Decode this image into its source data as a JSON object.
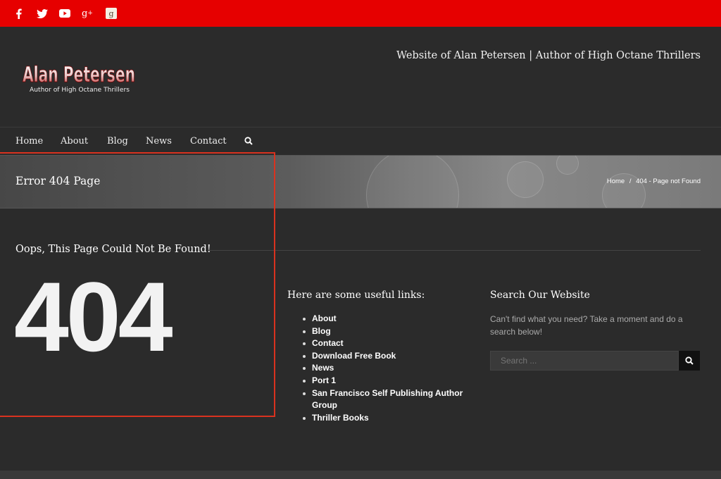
{
  "social": {
    "icons": [
      "facebook-icon",
      "twitter-icon",
      "youtube-icon",
      "google-plus-icon",
      "goodreads-icon"
    ]
  },
  "header": {
    "tagline": "Website of Alan Petersen | Author of High Octane Thrillers",
    "logo_name": "Alan Petersen",
    "logo_sub": "Author of High Octane Thrillers"
  },
  "nav": {
    "items": [
      "Home",
      "About",
      "Blog",
      "News",
      "Contact"
    ],
    "search_icon": "search-icon"
  },
  "page_title": {
    "title": "Error 404 Page",
    "breadcrumb": {
      "home": "Home",
      "separator": "/",
      "current": "404 - Page not Found"
    }
  },
  "main": {
    "heading": "Oops, This Page Could Not Be Found!",
    "code": "404"
  },
  "links": {
    "title": "Here are some useful links:",
    "items": [
      "About",
      "Blog",
      "Contact",
      "Download Free Book",
      "News",
      "Port 1",
      "San Francisco Self Publishing Author Group",
      "Thriller Books"
    ]
  },
  "search": {
    "title": "Search Our Website",
    "description": "Can't find what you need? Take a moment and do a search below!",
    "placeholder": "Search ..."
  },
  "colors": {
    "topbar": "#e60000",
    "background": "#2b2b2b",
    "highlight_box": "#d9321f"
  }
}
